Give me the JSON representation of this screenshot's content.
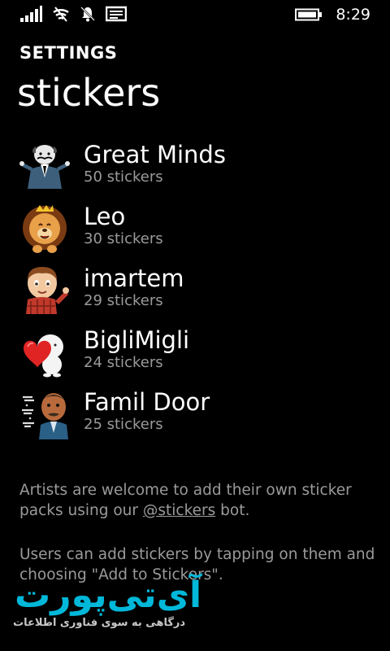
{
  "status_bar": {
    "time": "8:29",
    "icons": [
      "signal-icon",
      "wifi-icon",
      "silent-bell-icon",
      "message-icon",
      "battery-icon"
    ]
  },
  "header": {
    "app_title": "SETTINGS",
    "page_title": "stickers"
  },
  "packs": [
    {
      "name": "Great Minds",
      "count": "50 stickers",
      "thumb_icon": "great-minds-sticker-icon"
    },
    {
      "name": "Leo",
      "count": "30 stickers",
      "thumb_icon": "leo-lion-sticker-icon"
    },
    {
      "name": "imartem",
      "count": "29 stickers",
      "thumb_icon": "imartem-boy-sticker-icon"
    },
    {
      "name": "BigliMigli",
      "count": "24 stickers",
      "thumb_icon": "biglimigli-heart-sticker-icon"
    },
    {
      "name": "Famil Door",
      "count": "25 stickers",
      "thumb_icon": "famil-door-sticker-icon"
    }
  ],
  "info": {
    "artists_before": "Artists are welcome to add their own sticker packs using our ",
    "artists_link": "@stickers",
    "artists_after": " bot.",
    "users": "Users can add stickers by tapping on them and choosing \"Add to Stickers\"."
  },
  "watermark": {
    "logo": "آی‌تی‌پورت",
    "tagline": "درگاهی به سوی فناوری اطلاعات"
  },
  "colors": {
    "background": "#000000",
    "text": "#ffffff",
    "secondary_text": "#9a9a9a",
    "watermark_accent": "#00b8d9"
  }
}
